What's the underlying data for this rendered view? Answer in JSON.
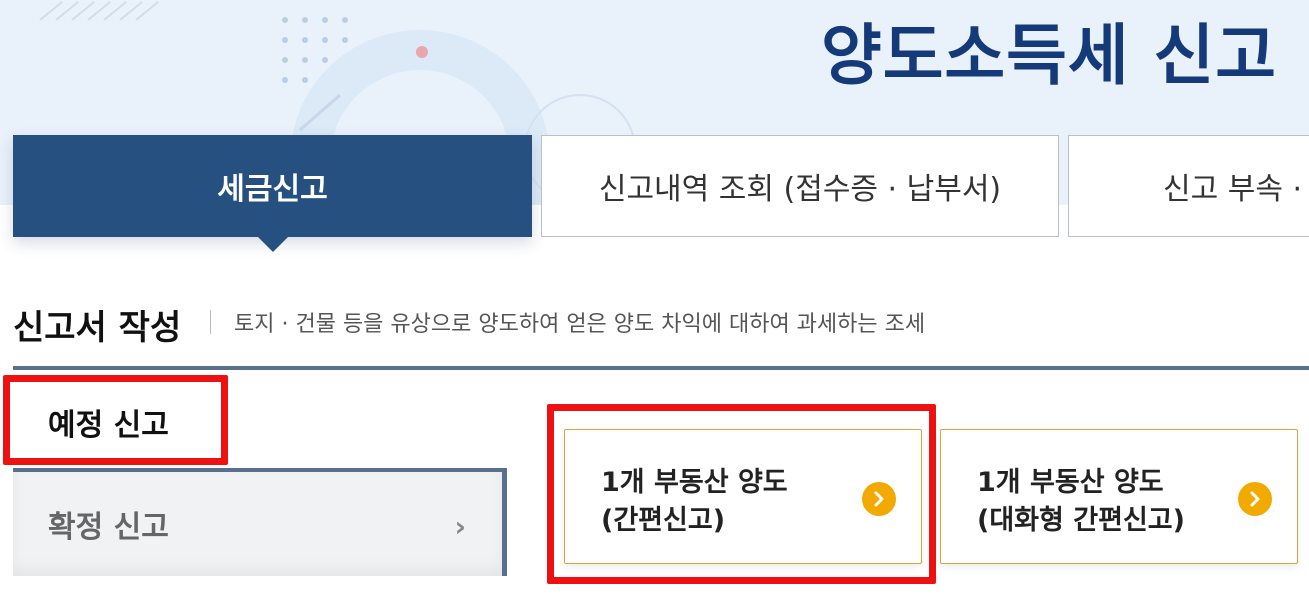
{
  "header": {
    "title": "양도소득세 신고"
  },
  "tabs": [
    {
      "label": "세금신고",
      "active": true
    },
    {
      "label": "신고내역 조회 (접수증 · 납부서)",
      "active": false
    },
    {
      "label": "신고 부속 ·",
      "active": false
    }
  ],
  "section": {
    "title": "신고서 작성",
    "description": "토지 · 건물 등을 유상으로 양도하여 얻은 양도 차익에 대하여 과세하는 조세"
  },
  "side_menu": [
    {
      "label": "예정 신고",
      "active": true
    },
    {
      "label": "확정 신고",
      "active": false,
      "arrow": "›"
    }
  ],
  "cards": [
    {
      "line1": "1개 부동산 양도",
      "line2": "(간편신고)",
      "icon": "chevron-right-circle-icon"
    },
    {
      "line1": "1개 부동산 양도",
      "line2": "(대화형 간편신고)",
      "icon": "chevron-right-circle-icon"
    }
  ],
  "colors": {
    "title": "#153a7a",
    "active_tab": "#26507f",
    "card_border": "#d7a53c",
    "go_button": "#f2a900",
    "highlight": "#ee1111",
    "banner_bg": "#e9f1fb"
  }
}
